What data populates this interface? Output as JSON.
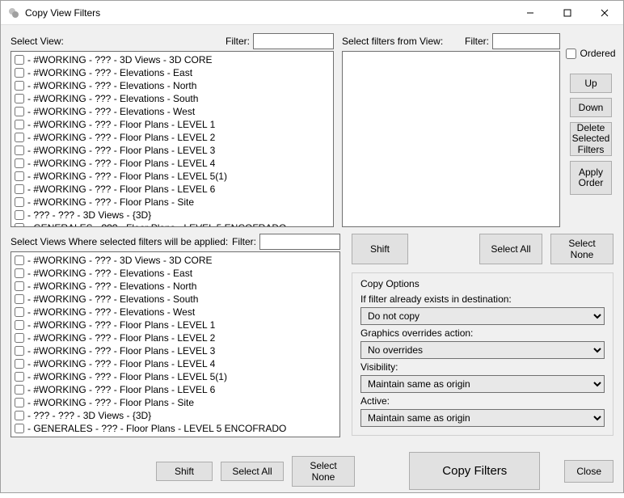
{
  "window": {
    "title": "Copy View Filters"
  },
  "panel1": {
    "label": "Select View:",
    "filter_label": "Filter:",
    "filter_value": ""
  },
  "panel2": {
    "label": "Select filters from View:",
    "filter_label": "Filter:",
    "filter_value": ""
  },
  "panel3": {
    "label": "Select Views Where selected filters will be applied:",
    "filter_label": "Filter:",
    "filter_value": ""
  },
  "views": [
    " - #WORKING - ??? - 3D Views - 3D CORE",
    " - #WORKING - ??? - Elevations - East",
    " - #WORKING - ??? - Elevations - North",
    " - #WORKING - ??? - Elevations - South",
    " - #WORKING - ??? - Elevations - West",
    " - #WORKING - ??? - Floor Plans - LEVEL 1",
    " - #WORKING - ??? - Floor Plans - LEVEL 2",
    " - #WORKING - ??? - Floor Plans - LEVEL 3",
    " - #WORKING - ??? - Floor Plans - LEVEL 4",
    " - #WORKING - ??? - Floor Plans - LEVEL 5(1)",
    " - #WORKING - ??? - Floor Plans - LEVEL 6",
    " - #WORKING - ??? - Floor Plans - Site",
    " - ??? - ??? - 3D Views - {3D}",
    " - GENERALES - ??? - Floor Plans - LEVEL 5 ENCOFRADO"
  ],
  "side": {
    "ordered": "Ordered",
    "up": "Up",
    "down": "Down",
    "del": "Delete Selected Filters",
    "apply": "Apply Order"
  },
  "filterButtons": {
    "shift": "Shift",
    "selectAll": "Select All",
    "selectNone": "Select None"
  },
  "targetButtons": {
    "shift": "Shift",
    "selectAll": "Select All",
    "selectNone": "Select None"
  },
  "copyOptions": {
    "group": "Copy Options",
    "existsLabel": "If filter already exists in destination:",
    "existsValue": "Do not copy",
    "graphicsLabel": "Graphics overrides action:",
    "graphicsValue": "No overrides",
    "visibilityLabel": "Visibility:",
    "visibilityValue": "Maintain same as origin",
    "activeLabel": "Active:",
    "activeValue": "Maintain same as origin"
  },
  "bottom": {
    "copy": "Copy Filters",
    "close": "Close"
  }
}
